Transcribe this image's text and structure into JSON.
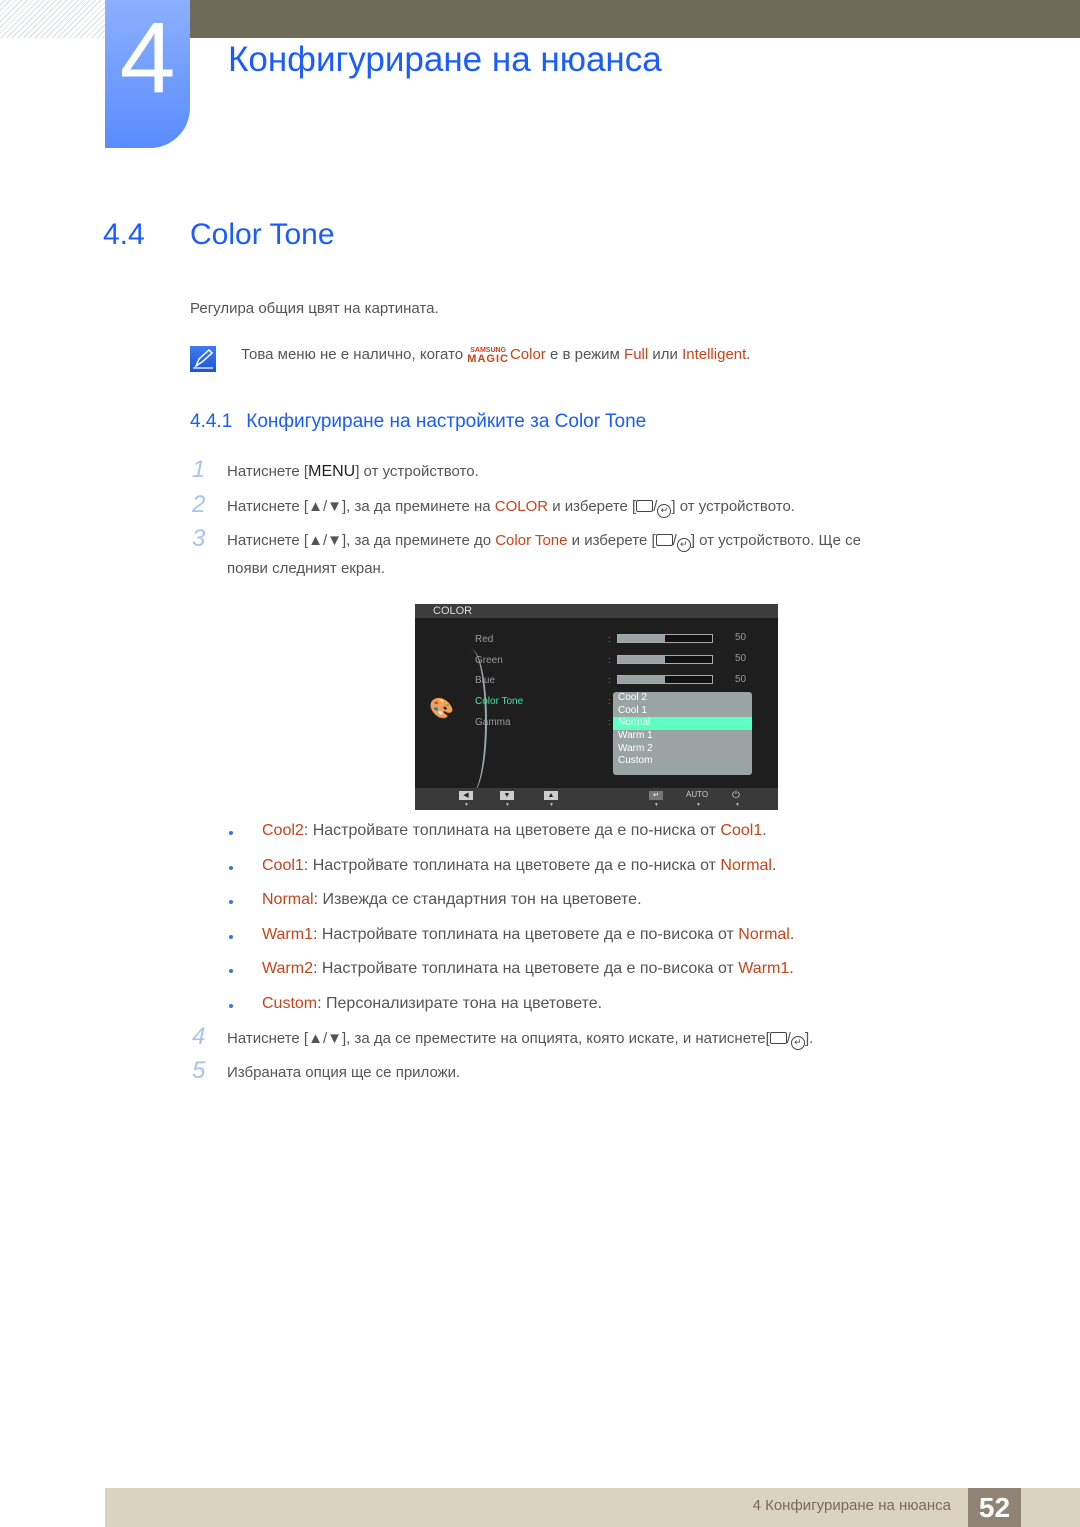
{
  "header": {
    "chapter_number": "4",
    "chapter_title": "Конфигуриране на нюанса"
  },
  "section": {
    "number": "4.4",
    "title": "Color Tone"
  },
  "intro": "Регулира общия цвят на картината.",
  "note": {
    "icon": "note-pencil-icon",
    "before": "Това меню не е налично, когато ",
    "brand_top": "SAMSUNG",
    "brand_bottom": "MAGIC",
    "brand_color": "Color",
    "middle": " е в режим ",
    "full": "Full",
    "or": " или ",
    "intelligent": "Intelligent",
    "end": "."
  },
  "subsection": {
    "number": "4.4.1",
    "title": "Конфигуриране на настройките за Color Tone"
  },
  "steps": [
    {
      "num": "1",
      "a": "Натиснете [",
      "key": "MENU",
      "b": "] от устройството."
    },
    {
      "num": "2",
      "a": "Натиснете [▲/▼], за да преминете на ",
      "hl": "COLOR",
      "b": " и изберете [",
      "c": "] от устройството."
    },
    {
      "num": "3",
      "a": "Натиснете [▲/▼], за да преминете до ",
      "hl": "Color Tone",
      "b": " и изберете [",
      "c": "] от устройството. Ще се",
      "d": "появи следният екран."
    },
    {
      "num": "4",
      "a": "Натиснете [▲/▼], за да се преместите на опцията, която искате, и натиснете[",
      "c": "]."
    },
    {
      "num": "5",
      "a": "Избраната опция ще се приложи."
    }
  ],
  "osd": {
    "title": "COLOR",
    "items": [
      {
        "label": "Red",
        "value": "50",
        "fraction": 0.5
      },
      {
        "label": "Green",
        "value": "50",
        "fraction": 0.5
      },
      {
        "label": "Blue",
        "value": "50",
        "fraction": 0.5
      },
      {
        "label": "Color Tone"
      },
      {
        "label": "Gamma"
      }
    ],
    "options": [
      "Cool 2",
      "Cool 1",
      "Normal",
      "Warm 1",
      "Warm 2",
      "Custom"
    ],
    "selected": "Normal",
    "footer_auto": "AUTO",
    "highlight_color": "#5effc0"
  },
  "bullets": [
    {
      "term": "Cool2",
      "text": ": Настройвате топлината на цветовете да е по-ниска от ",
      "ref": "Cool1",
      "end": "."
    },
    {
      "term": "Cool1",
      "text": ": Настройвате топлината на цветовете да е по-ниска от ",
      "ref": "Normal",
      "end": "."
    },
    {
      "term": "Normal",
      "text": ": Извежда се стандартния тон на цветовете.",
      "ref": "",
      "end": ""
    },
    {
      "term": "Warm1",
      "text": ": Настройвате топлината на цветовете да е по-висока от ",
      "ref": "Normal",
      "end": "."
    },
    {
      "term": "Warm2",
      "text": ": Настройвате топлината на цветовете да е по-висока от ",
      "ref": "Warm1",
      "end": "."
    },
    {
      "term": "Custom",
      "text": ": Персонализирате тона на цветовете.",
      "ref": "",
      "end": ""
    }
  ],
  "footer": {
    "text": "4 Конфигуриране на нюанса",
    "page": "52"
  },
  "colors": {
    "heading_blue": "#1a5cff",
    "highlight": "#c8441a",
    "topbar": "#6e6c59",
    "footer": "#d9d3bf"
  }
}
